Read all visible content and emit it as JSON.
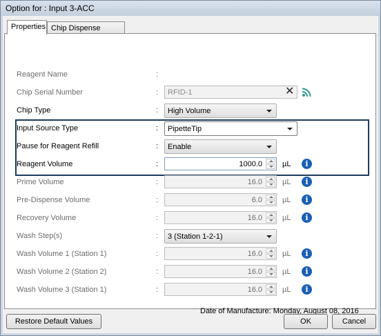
{
  "window": {
    "title": "Option for : Input 3-ACC"
  },
  "tabs": [
    {
      "label": "Properties"
    },
    {
      "label": "Chip Dispense History"
    }
  ],
  "rows": {
    "reagent_name": {
      "label": "Reagent Name"
    },
    "chip_serial_number": {
      "label": "Chip Serial Number",
      "value": "RFID-1"
    },
    "chip_type": {
      "label": "Chip Type",
      "value": "High Volume"
    },
    "input_source_type": {
      "label": "Input Source Type",
      "value": "PipetteTip"
    },
    "pause_for_reagent_refill": {
      "label": "Pause for Reagent Refill",
      "value": "Enable"
    },
    "reagent_volume": {
      "label": "Reagent Volume",
      "value": "1000.0",
      "unit": "µL"
    },
    "prime_volume": {
      "label": "Prime Volume",
      "value": "16.0",
      "unit": "µL"
    },
    "pre_dispense_volume": {
      "label": "Pre-Dispense Volume",
      "value": "6.0",
      "unit": "µL"
    },
    "recovery_volume": {
      "label": "Recovery Volume",
      "value": "16.0",
      "unit": "µL"
    },
    "wash_steps": {
      "label": "Wash Step(s)",
      "value": "3 (Station 1-2-1)"
    },
    "wash_volume_1": {
      "label": "Wash Volume 1 (Station 1)",
      "value": "16.0",
      "unit": "µL"
    },
    "wash_volume_2": {
      "label": "Wash Volume 2 (Station 2)",
      "value": "16.0",
      "unit": "µL"
    },
    "wash_volume_3": {
      "label": "Wash Volume 3 (Station 1)",
      "value": "16.0",
      "unit": "µL"
    }
  },
  "colon": ":",
  "date_of_manufacture": "Date of Manufacture: Monday, August 08, 2016",
  "buttons": {
    "restore": "Restore Default Values",
    "ok": "OK",
    "cancel": "Cancel"
  },
  "icons": {
    "info": "info-icon",
    "rss": "rss-icon",
    "clear": "close-icon"
  },
  "colors": {
    "highlight_border": "#1b3a5c",
    "info_blue": "#1a5fb4",
    "rss_green": "#2e9c8a"
  }
}
